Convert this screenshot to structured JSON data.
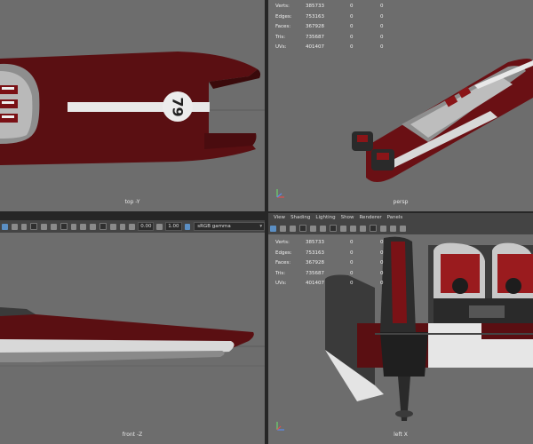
{
  "viewports": {
    "top": {
      "label": "top -Y",
      "hull_number": "79"
    },
    "persp": {
      "label": "persp",
      "stats": [
        {
          "name": "Verts:",
          "value": "385733",
          "sel": "0",
          "comp": "0"
        },
        {
          "name": "Edges:",
          "value": "753163",
          "sel": "0",
          "comp": "0"
        },
        {
          "name": "Faces:",
          "value": "367928",
          "sel": "0",
          "comp": "0"
        },
        {
          "name": "Tris:",
          "value": "735687",
          "sel": "0",
          "comp": "0"
        },
        {
          "name": "UVs:",
          "value": "401407",
          "sel": "0",
          "comp": "0"
        }
      ]
    },
    "front": {
      "label": "front -Z"
    },
    "left": {
      "label": "left X",
      "stats": [
        {
          "name": "Verts:",
          "value": "385733",
          "sel": "0",
          "comp": "0"
        },
        {
          "name": "Edges:",
          "value": "753163",
          "sel": "0",
          "comp": "0"
        },
        {
          "name": "Faces:",
          "value": "367928",
          "sel": "0",
          "comp": "0"
        },
        {
          "name": "Tris:",
          "value": "735687",
          "sel": "0",
          "comp": "0"
        },
        {
          "name": "UVs:",
          "value": "401407",
          "sel": "0",
          "comp": "0"
        }
      ]
    }
  },
  "toolbar_front": {
    "exposure": "0.00",
    "gamma": "1.00",
    "color_space": "sRGB gamma"
  },
  "menu_left": {
    "items": [
      "View",
      "Shading",
      "Lighting",
      "Show",
      "Renderer",
      "Panels"
    ]
  },
  "colors": {
    "viewport_bg": "#6d6d6d",
    "hull_red": "#5e0f12",
    "hull_white": "#e6e6e6",
    "toolbar": "#444444"
  }
}
